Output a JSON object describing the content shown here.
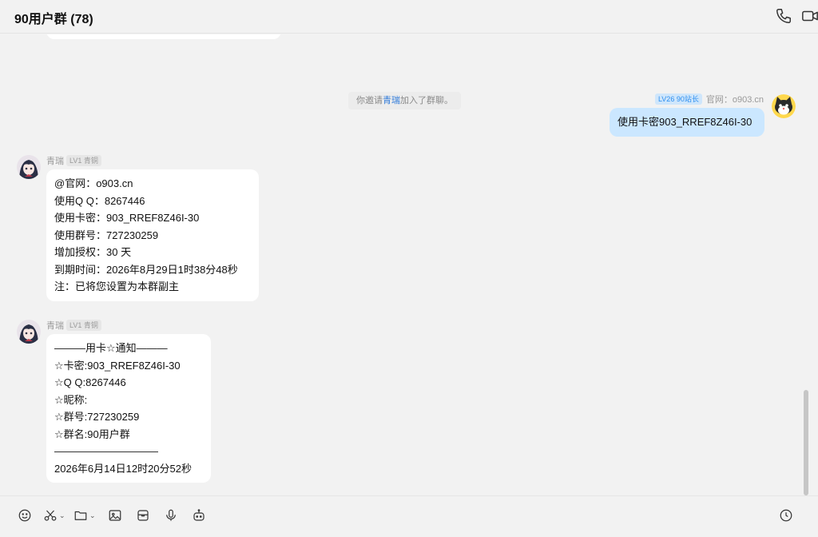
{
  "header": {
    "title": "90用户群 (78)"
  },
  "system_notice": {
    "prefix": "你邀请",
    "name": "青瑞",
    "suffix": "加入了群聊。"
  },
  "messages": [
    {
      "sender_title": "LV26 90站长",
      "sender_name": "官网：o903.cn",
      "lines": [
        "使用卡密903_RREF8Z46I-30"
      ]
    },
    {
      "sender_name": "青瑞",
      "sender_level": "LV1 青铜",
      "lines": [
        "@官网：o903.cn",
        "使用Q Q：8267446",
        "使用卡密：903_RREF8Z46I-30",
        "使用群号：727230259",
        "增加授权：30 天",
        "到期时间：2026年8月29日1时38分48秒",
        "注：已将您设置为本群副主"
      ]
    },
    {
      "sender_name": "青瑞",
      "sender_level": "LV1 青铜",
      "lines": [
        "———用卡☆通知———",
        "☆卡密:903_RREF8Z46I-30",
        "☆Q Q:8267446",
        "☆昵称:",
        "☆群号:727230259",
        "☆群名:90用户群",
        "——————————",
        "2026年6月14日12时20分52秒"
      ]
    }
  ],
  "icons": {
    "header": [
      "phone-icon",
      "video-icon"
    ],
    "toolbar": [
      "emoji-icon",
      "scissors-icon",
      "folder-icon",
      "image-icon",
      "mailbox-icon",
      "microphone-icon",
      "robot-icon",
      "history-clock-icon"
    ]
  },
  "colors": {
    "my_bubble": "#cbe7ff",
    "other_bubble": "#ffffff",
    "link": "#2f7ad9",
    "title_badge": "#2d8ff0"
  }
}
